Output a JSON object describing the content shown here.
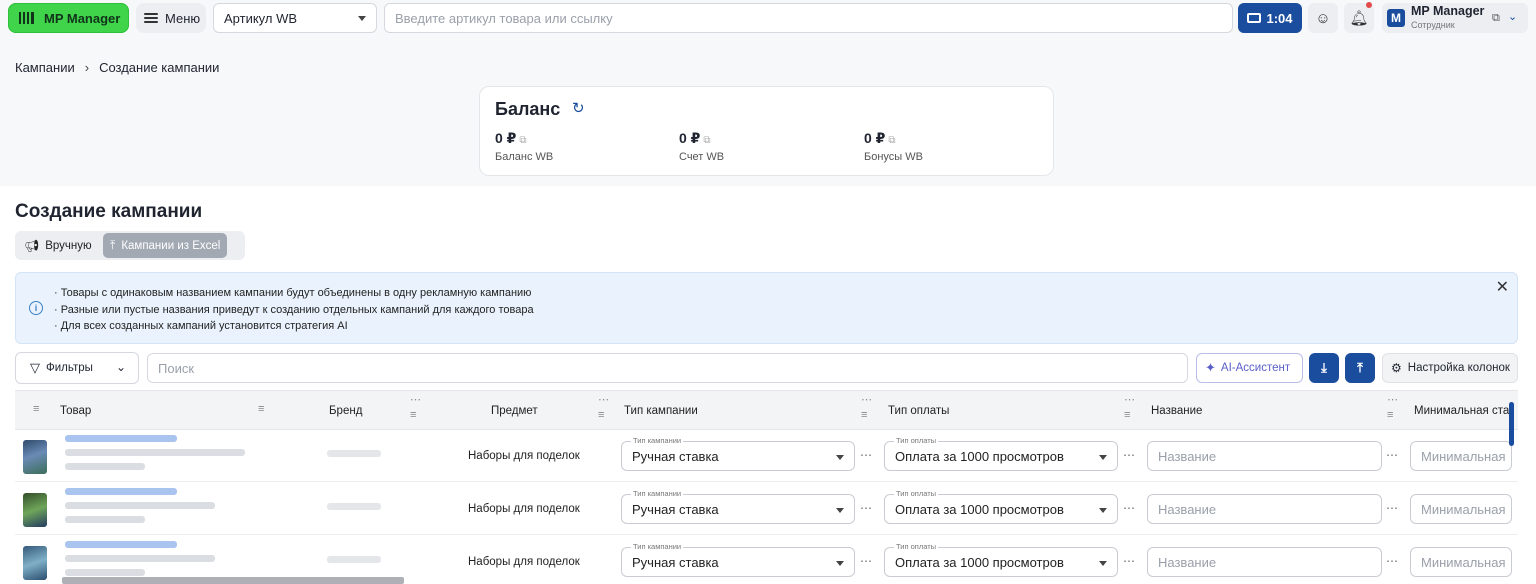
{
  "header": {
    "logo_label": "MP Manager",
    "menu_label": "Меню",
    "articul_select": "Артикул WB",
    "search_placeholder": "Введите артикул товара или ссылку",
    "video_time": "1:04",
    "profile": {
      "name": "MP Manager",
      "role": "Сотрудник",
      "initial": "M"
    }
  },
  "breadcrumb": {
    "root": "Кампании",
    "current": "Создание кампании"
  },
  "balance": {
    "title": "Баланс",
    "items": [
      {
        "value": "0 ₽",
        "label": "Баланс WB"
      },
      {
        "value": "0 ₽",
        "label": "Счет WB"
      },
      {
        "value": "0 ₽",
        "label": "Бонусы WB"
      }
    ]
  },
  "page": {
    "title": "Создание кампании",
    "tabs": [
      {
        "label": "Вручную",
        "active": false
      },
      {
        "label": "Кампании из Excel",
        "active": true
      }
    ],
    "info_lines": [
      "· Товары с одинаковым названием кампании будут объединены в одну рекламную кампанию",
      "· Разные или пустые названия приведут к созданию отдельных кампаний для каждого товара",
      "· Для всех созданных кампаний установится стратегия AI"
    ]
  },
  "toolbar": {
    "filters_label": "Фильтры",
    "search_placeholder": "Поиск",
    "ai_label": "AI-Ассистент",
    "columns_label": "Настройка колонок"
  },
  "table": {
    "columns": [
      "Товар",
      "Бренд",
      "Предмет",
      "Тип кампании",
      "Тип оплаты",
      "Название",
      "Минимальная ста"
    ],
    "field_labels": {
      "campaign_type": "Тип кампании",
      "payment_type": "Тип оплаты"
    },
    "name_placeholder": "Название",
    "min_placeholder": "Минимальная",
    "rows": [
      {
        "subject": "Наборы для поделок",
        "campaign_type": "Ручная ставка",
        "payment_type": "Оплата за 1000 просмотров"
      },
      {
        "subject": "Наборы для поделок",
        "campaign_type": "Ручная ставка",
        "payment_type": "Оплата за 1000 просмотров"
      },
      {
        "subject": "Наборы для поделок",
        "campaign_type": "Ручная ставка",
        "payment_type": "Оплата за 1000 просмотров"
      }
    ]
  },
  "colors": {
    "accent": "#1a4d9e",
    "logo_green": "#3fd44a",
    "info_bg": "#eaf3fd"
  }
}
